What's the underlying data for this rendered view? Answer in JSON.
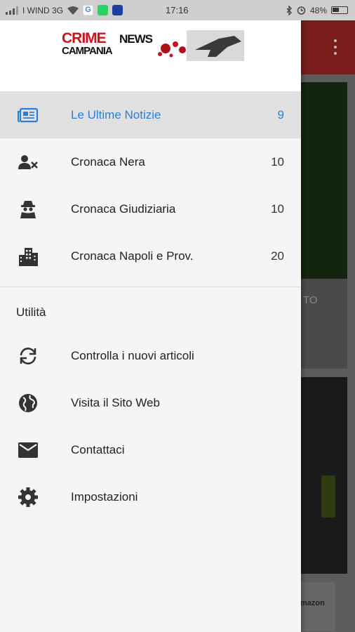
{
  "status_bar": {
    "carrier": "I WIND 3G",
    "time": "17:16",
    "battery": "48%"
  },
  "logo": {
    "crime": "CRIME",
    "news": "NEWS",
    "campania": "CAMPANIA"
  },
  "categories": [
    {
      "label": "Le Ultime Notizie",
      "count": "9",
      "icon": "newspaper-icon",
      "active": true
    },
    {
      "label": "Cronaca Nera",
      "count": "10",
      "icon": "person-cross-icon"
    },
    {
      "label": "Cronaca Giudiziaria",
      "count": "10",
      "icon": "spy-icon"
    },
    {
      "label": "Cronaca Napoli e Prov.",
      "count": "20",
      "icon": "city-icon"
    }
  ],
  "section_title": "Utilità",
  "utilities": [
    {
      "label": "Controlla i nuovi articoli",
      "icon": "sync-icon"
    },
    {
      "label": "Visita il Sito Web",
      "icon": "globe-icon"
    },
    {
      "label": "Contattaci",
      "icon": "mail-icon"
    },
    {
      "label": "Impostazioni",
      "icon": "gear-icon"
    }
  ],
  "background": {
    "card_text": "TO",
    "ad_text": "mazon"
  },
  "colors": {
    "accent": "#2980d9",
    "toolbar": "#b71c1c"
  }
}
